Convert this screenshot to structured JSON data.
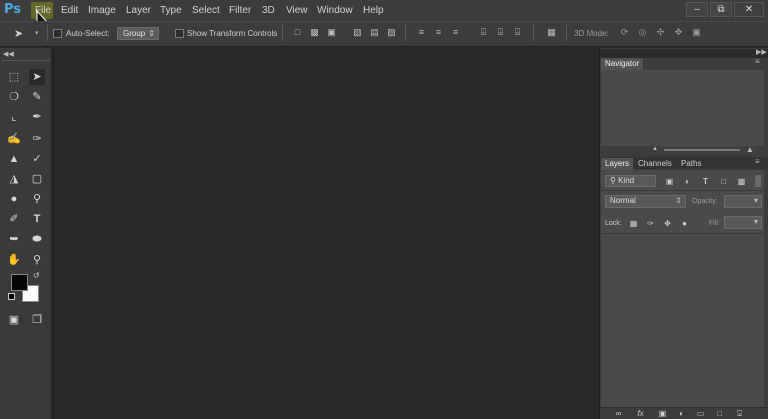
{
  "app": {
    "logo_text": "Ps",
    "menus": [
      "File",
      "Edit",
      "Image",
      "Layer",
      "Type",
      "Select",
      "Filter",
      "3D",
      "View",
      "Window",
      "Help"
    ],
    "active_menu": "File",
    "highlight_color": "#8a8a18",
    "window_controls": [
      "minimize-icon",
      "restore-icon",
      "close-icon"
    ]
  },
  "options_bar": {
    "auto_select_label": "Auto-Select:",
    "group_value": "Group",
    "show_transform_label": "Show Transform Controls",
    "mode_3d_label": "3D Mode:"
  },
  "navigator": {
    "tab": "Navigator"
  },
  "layers_panel": {
    "tabs": [
      "Layers",
      "Channels",
      "Paths"
    ],
    "active_tab": "Layers",
    "kind_label": "Kind",
    "blend_mode": "Normal",
    "opacity_label": "Opacity:",
    "lock_label": "Lock:",
    "fill_label": "Fill:"
  },
  "colors": {
    "foreground": "#050505",
    "background": "#ffffff",
    "logo": "#4aa8e8"
  }
}
